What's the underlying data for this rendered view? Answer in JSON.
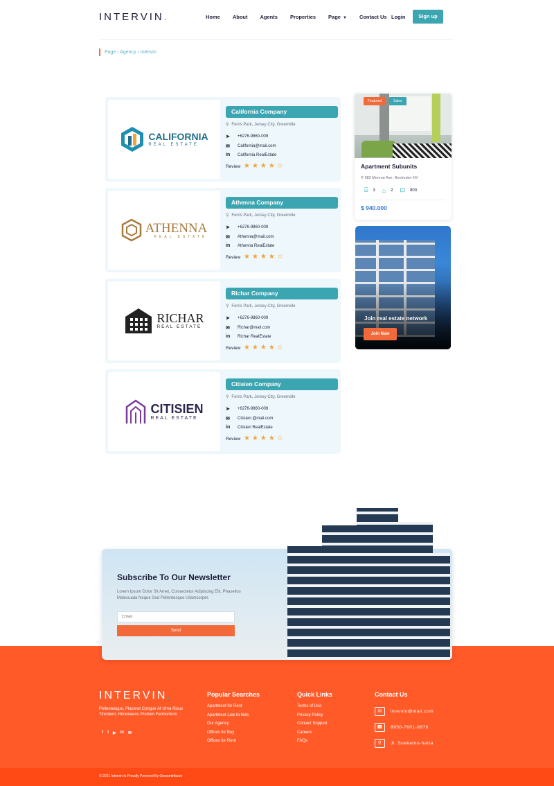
{
  "brand": {
    "name": "INTERVIN",
    "dot": "."
  },
  "nav": {
    "items": [
      "Home",
      "About",
      "Agents",
      "Properties",
      "Page",
      "Contact Us"
    ],
    "login": "Login",
    "signup": "Sign up"
  },
  "breadcrumb": "Page › Agency › Intervin",
  "agencies": [
    {
      "title": "California Company",
      "address": "Ferris Park, Jersey City, Greenville",
      "phone": "+6276-9860-009",
      "email": "California@mail.com",
      "linkedin": "California RealEstate",
      "review_label": "Review",
      "rating": 4,
      "logo_top": "CALIFORNIA",
      "logo_bottom": "REAL ESTATE",
      "logo_color": "#1e6e8c"
    },
    {
      "title": "Athenna Company",
      "address": "Ferris Park, Jersey City, Greenville",
      "phone": "+6276-9860-009",
      "email": "Athenna@mail.com",
      "linkedin": "Athenna RealEstate",
      "review_label": "Review",
      "rating": 4,
      "logo_top": "ATHENNA",
      "logo_bottom": "REAL ESTATE",
      "logo_color": "#a87a3e"
    },
    {
      "title": "Richar Company",
      "address": "Ferris Park, Jersey City, Greenville",
      "phone": "+6276-9860-009",
      "email": "Richar@mail.com",
      "linkedin": "Richar RealEstate",
      "review_label": "Review",
      "rating": 4,
      "logo_top": "RICHAR",
      "logo_bottom": "REAL ESTATE",
      "logo_color": "#222222"
    },
    {
      "title": "Citisien Company",
      "address": "Ferris Park, Jersey City, Greenville",
      "phone": "+6276-9860-009",
      "email": "Citisien @mail.com",
      "linkedin": "Citisien RealEstate",
      "review_label": "Review",
      "rating": 4,
      "logo_top": "CITISIEN",
      "logo_bottom": "REAL ESTATE",
      "logo_color": "#2b2550"
    }
  ],
  "featured": {
    "badge_featured": "Featured",
    "badge_sales": "Sales",
    "name": "Apartment Subunits",
    "location": "982 Monroe Ave, Rochester NY",
    "beds": "3",
    "baths": "2",
    "area": "800",
    "price": "$ 940.000"
  },
  "join": {
    "text": "Join real estate network",
    "button": "Join Now"
  },
  "newsletter": {
    "title": "Subscribe To Our Newsletter",
    "description": "Lorem Ipsum Dolor Sit Amet, Consectetur Adipiscing Elit. Phasellus Malesuada Neque Sed Pellentesque Ullamcorper.",
    "email_placeholder": "Email",
    "send": "Send"
  },
  "footer": {
    "description": "Pellentesque, Placerat Congue At Urna Risus Tincidunt, Himenaeos Pretium Fermentum",
    "social": [
      "f",
      "t",
      "▶",
      "in",
      "✉"
    ],
    "popular": {
      "title": "Popular Searches",
      "items": [
        "Apartment for Rent",
        "Apartment Low to hide",
        "Our Agency",
        "Offices for Buy",
        "Offices for Rent"
      ]
    },
    "quick": {
      "title": "Quick Links",
      "items": [
        "Terms of Use",
        "Privacy Policy",
        "Contact Support",
        "Careers",
        "FAQs"
      ]
    },
    "contact": {
      "title": "Contact Us",
      "email": "intervin@mail.com",
      "phone": "8950-7601-9876",
      "address": "Jl. Soekarno-hatta"
    },
    "copyright": "© 2021 Intervin Is Proudly Powered By Onecontributor"
  },
  "colors": {
    "accent": "#3ca5b2",
    "orange": "#ff5a28",
    "star": "#f2a43a"
  }
}
